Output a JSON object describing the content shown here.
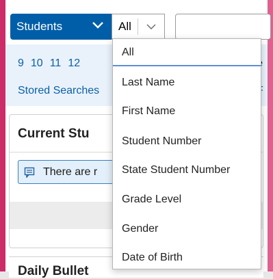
{
  "header": {
    "record_type": "Students",
    "search_field": "All"
  },
  "grade_links": [
    "9",
    "10",
    "11",
    "12"
  ],
  "stored_searches_label": "Stored Searches",
  "obscured_fragments": {
    "right_top": "e",
    "right_bottom": "F",
    "panel_title": "Current Stu",
    "info_message": "There are r",
    "bottom_title": "Daily Bullet"
  },
  "dropdown": {
    "options": [
      "All",
      "Last Name",
      "First Name",
      "Student Number",
      "State Student Number",
      "Grade Level",
      "Gender",
      "Date of Birth"
    ]
  },
  "colors": {
    "primary_blue": "#005ea8",
    "link_blue": "#0a5fa8",
    "accent_pink": "#cc2c67"
  }
}
